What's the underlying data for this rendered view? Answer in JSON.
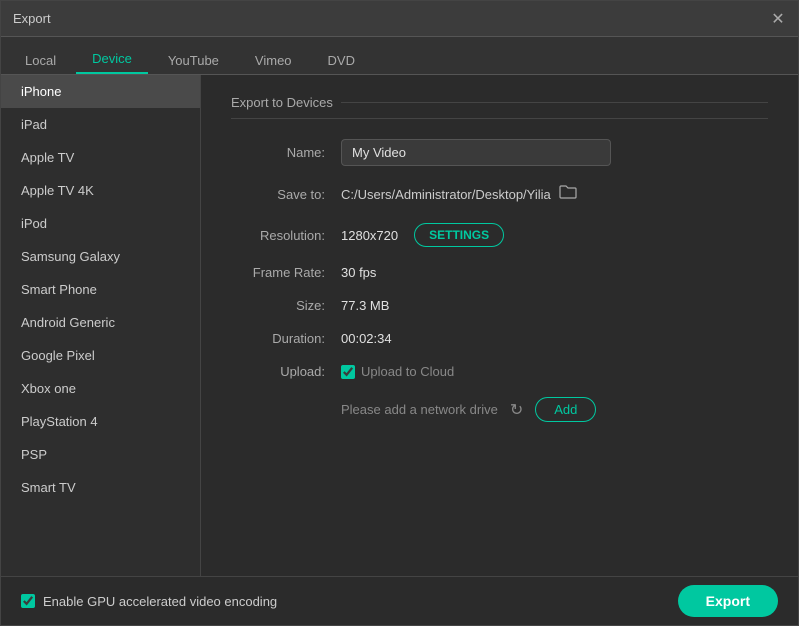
{
  "window": {
    "title": "Export",
    "close_icon": "✕"
  },
  "tabs": [
    {
      "id": "local",
      "label": "Local",
      "active": false
    },
    {
      "id": "device",
      "label": "Device",
      "active": true
    },
    {
      "id": "youtube",
      "label": "YouTube",
      "active": false
    },
    {
      "id": "vimeo",
      "label": "Vimeo",
      "active": false
    },
    {
      "id": "dvd",
      "label": "DVD",
      "active": false
    }
  ],
  "sidebar": {
    "items": [
      {
        "id": "iphone",
        "label": "iPhone",
        "active": true
      },
      {
        "id": "ipad",
        "label": "iPad",
        "active": false
      },
      {
        "id": "apple-tv",
        "label": "Apple TV",
        "active": false
      },
      {
        "id": "apple-tv-4k",
        "label": "Apple TV 4K",
        "active": false
      },
      {
        "id": "ipod",
        "label": "iPod",
        "active": false
      },
      {
        "id": "samsung-galaxy",
        "label": "Samsung Galaxy",
        "active": false
      },
      {
        "id": "smart-phone",
        "label": "Smart Phone",
        "active": false
      },
      {
        "id": "android-generic",
        "label": "Android Generic",
        "active": false
      },
      {
        "id": "google-pixel",
        "label": "Google Pixel",
        "active": false
      },
      {
        "id": "xbox-one",
        "label": "Xbox one",
        "active": false
      },
      {
        "id": "playstation-4",
        "label": "PlayStation 4",
        "active": false
      },
      {
        "id": "psp",
        "label": "PSP",
        "active": false
      },
      {
        "id": "smart-tv",
        "label": "Smart TV",
        "active": false
      }
    ]
  },
  "main": {
    "section_title": "Export to Devices",
    "name_label": "Name:",
    "name_value": "My Video",
    "save_to_label": "Save to:",
    "save_to_path": "C:/Users/Administrator/Desktop/Yilia",
    "folder_icon": "🗁",
    "resolution_label": "Resolution:",
    "resolution_value": "1280x720",
    "settings_button": "SETTINGS",
    "frame_rate_label": "Frame Rate:",
    "frame_rate_value": "30 fps",
    "size_label": "Size:",
    "size_value": "77.3 MB",
    "duration_label": "Duration:",
    "duration_value": "00:02:34",
    "upload_label": "Upload:",
    "upload_cloud_label": "Upload to Cloud",
    "network_drive_text": "Please add a network drive",
    "refresh_icon": "↻",
    "add_button": "Add"
  },
  "bottom": {
    "gpu_label": "Enable GPU accelerated video encoding",
    "export_button": "Export"
  }
}
